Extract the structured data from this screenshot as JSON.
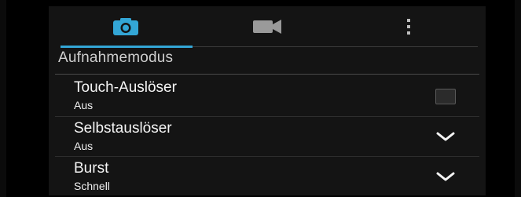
{
  "tabs": [
    {
      "name": "camera",
      "icon": "camera-icon",
      "active": true
    },
    {
      "name": "video",
      "icon": "video-camera-icon",
      "active": false
    },
    {
      "name": "more",
      "icon": "overflow-menu-icon",
      "active": false
    }
  ],
  "colors": {
    "accent": "#33a6d6",
    "background": "#141414"
  },
  "section": {
    "title": "Aufnahmemodus"
  },
  "settings": [
    {
      "title": "Touch-Auslöser",
      "summary": "Aus",
      "control": "checkbox",
      "checked": false
    },
    {
      "title": "Selbstauslöser",
      "summary": "Aus",
      "control": "dropdown"
    },
    {
      "title": "Burst",
      "summary": "Schnell",
      "control": "dropdown"
    }
  ]
}
